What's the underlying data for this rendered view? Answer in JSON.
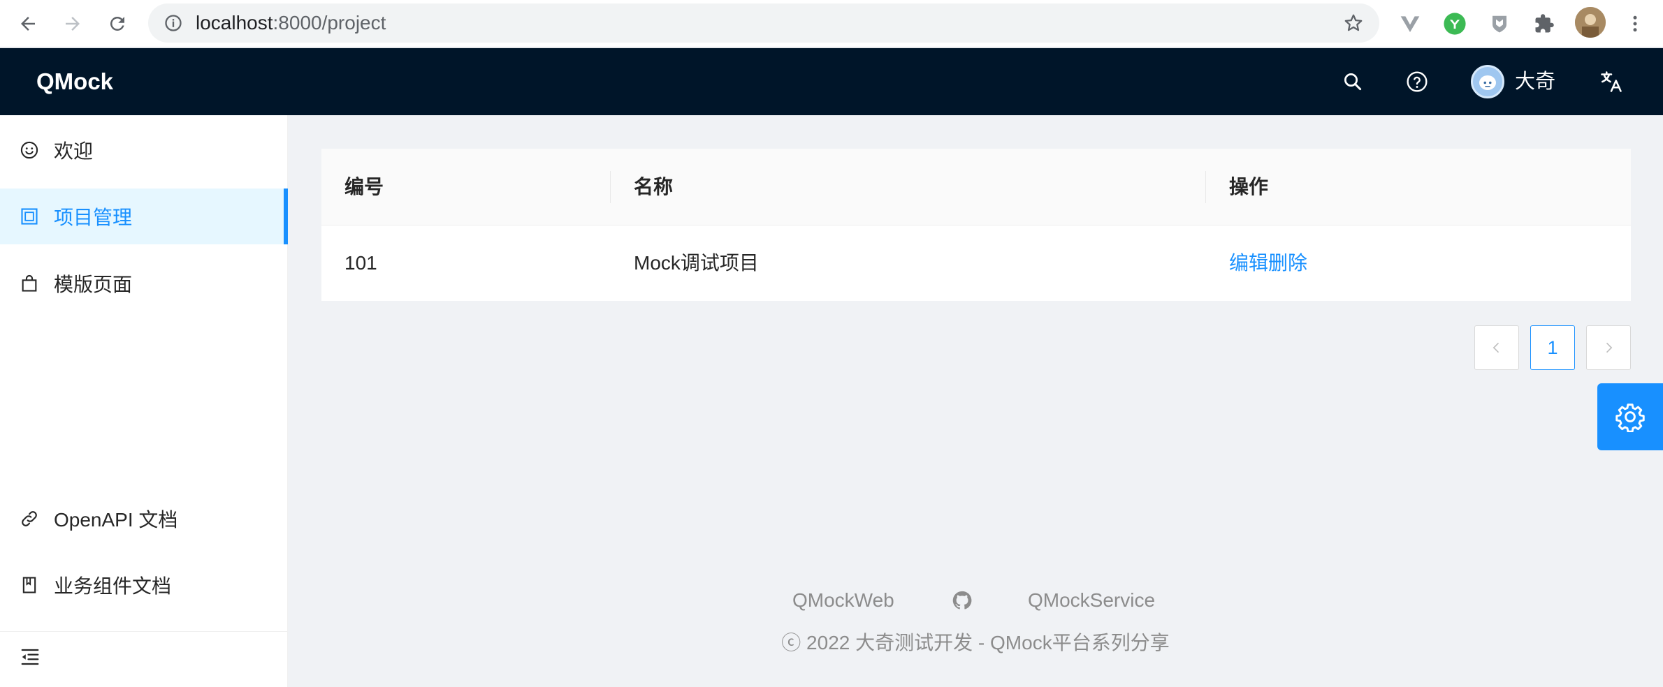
{
  "browser": {
    "url_host": "localhost",
    "url_path": ":8000/project"
  },
  "header": {
    "logo": "QMock",
    "username": "大奇"
  },
  "sidebar": {
    "items": [
      {
        "label": "欢迎",
        "icon": "smile-icon"
      },
      {
        "label": "项目管理",
        "icon": "project-icon",
        "active": true
      },
      {
        "label": "模版页面",
        "icon": "shopping-bag-icon"
      },
      {
        "label": "OpenAPI 文档",
        "icon": "link-icon"
      },
      {
        "label": "业务组件文档",
        "icon": "book-icon"
      }
    ]
  },
  "table": {
    "columns": [
      "编号",
      "名称",
      "操作"
    ],
    "rows": [
      {
        "id": "101",
        "name": "Mock调试项目",
        "edit": "编辑",
        "delete": "删除"
      }
    ]
  },
  "pagination": {
    "prev": "<",
    "current": "1",
    "next": ">"
  },
  "footer": {
    "link_web": "QMockWeb",
    "link_service": "QMockService",
    "copyright": "ⓒ 2022 大奇测试开发 - QMock平台系列分享"
  },
  "colors": {
    "header_bg": "#001529",
    "accent": "#1890ff",
    "active_menu_bg": "#e6f7ff"
  }
}
